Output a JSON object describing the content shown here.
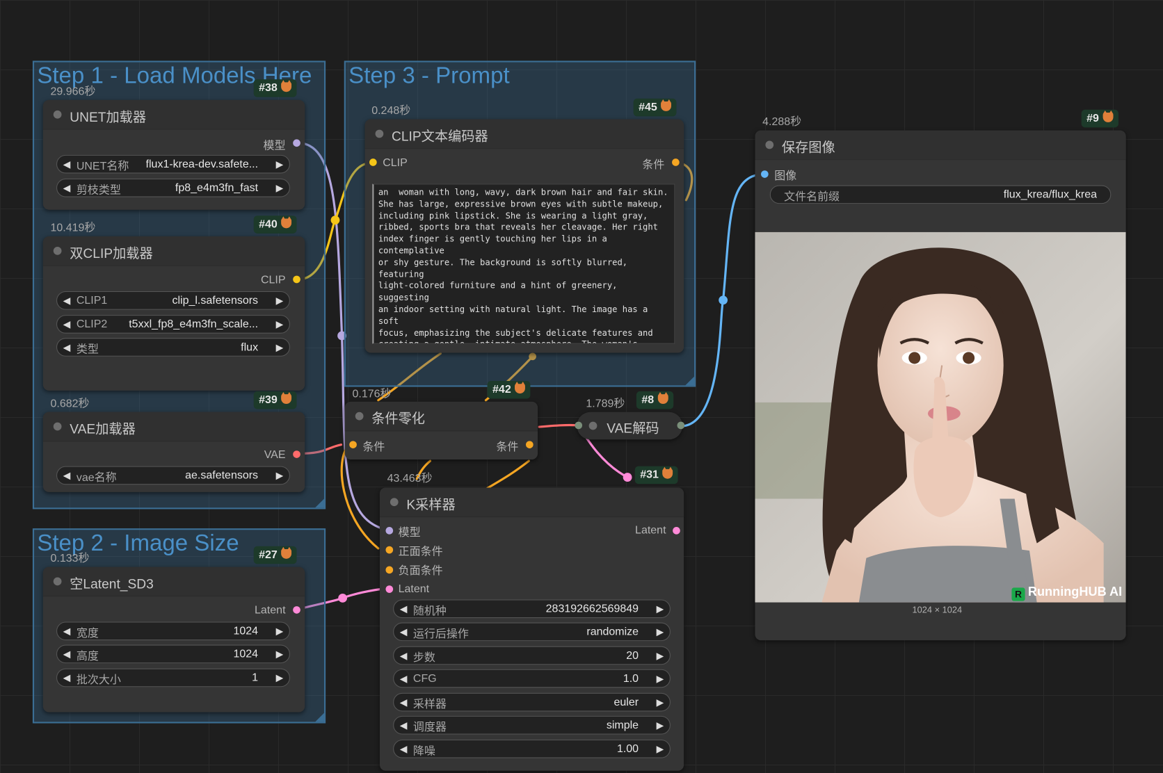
{
  "colors": {
    "model": "#b6a8e0",
    "clip": "#f5c518",
    "vae": "#ff6b6b",
    "conditioning": "#f5a623",
    "latent": "#ff8ad8",
    "image": "#64b5f6",
    "group": "#3b6e94"
  },
  "groups": {
    "step1": "Step 1 - Load Models Here",
    "step2": "Step 2 - Image Size",
    "step3": "Step 3 - Prompt"
  },
  "nodes": {
    "unet": {
      "time": "29.966秒",
      "badge": "#38",
      "title": "UNET加载器",
      "output": "模型",
      "widgets": [
        {
          "label": "UNET名称",
          "value": "flux1-krea-dev.safete..."
        },
        {
          "label": "剪枝类型",
          "value": "fp8_e4m3fn_fast"
        }
      ]
    },
    "dualclip": {
      "time": "10.419秒",
      "badge": "#40",
      "title": "双CLIP加载器",
      "output": "CLIP",
      "widgets": [
        {
          "label": "CLIP1",
          "value": "clip_l.safetensors"
        },
        {
          "label": "CLIP2",
          "value": "t5xxl_fp8_e4m3fn_scale..."
        },
        {
          "label": "类型",
          "value": "flux"
        }
      ]
    },
    "vaeloader": {
      "time": "0.682秒",
      "badge": "#39",
      "title": "VAE加载器",
      "output": "VAE",
      "widgets": [
        {
          "label": "vae名称",
          "value": "ae.safetensors"
        }
      ]
    },
    "latent": {
      "time": "0.133秒",
      "badge": "#27",
      "title": "空Latent_SD3",
      "output": "Latent",
      "widgets": [
        {
          "label": "宽度",
          "value": "1024"
        },
        {
          "label": "高度",
          "value": "1024"
        },
        {
          "label": "批次大小",
          "value": "1"
        }
      ]
    },
    "clipencode": {
      "time": "0.248秒",
      "badge": "#45",
      "title": "CLIP文本编码器",
      "input": "CLIP",
      "output": "条件",
      "prompt": "an  woman with long, wavy, dark brown hair and fair skin.\nShe has large, expressive brown eyes with subtle makeup,\nincluding pink lipstick. She is wearing a light gray,\nribbed, sports bra that reveals her cleavage. Her right\nindex finger is gently touching her lips in a contemplative\nor shy gesture. The background is softly blurred, featuring\nlight-colored furniture and a hint of greenery, suggesting\nan indoor setting with natural light. The image has a soft\nfocus, emphasizing the subject's delicate features and\ncreating a gentle, intimate atmosphere. The woman's overall\nappearance is youthful and attractive."
    },
    "zero": {
      "time": "0.176秒",
      "badge": "#42",
      "title": "条件零化",
      "input": "条件",
      "output": "条件"
    },
    "vaedecode": {
      "time": "1.789秒",
      "badge": "#8",
      "title": "VAE解码"
    },
    "ksampler": {
      "time": "43.463秒",
      "badge": "#31",
      "title": "K采样器",
      "inputs": [
        "模型",
        "正面条件",
        "负面条件",
        "Latent"
      ],
      "output": "Latent",
      "widgets": [
        {
          "label": "随机种",
          "value": "283192662569849"
        },
        {
          "label": "运行后操作",
          "value": "randomize"
        },
        {
          "label": "步数",
          "value": "20"
        },
        {
          "label": "CFG",
          "value": "1.0"
        },
        {
          "label": "采样器",
          "value": "euler"
        },
        {
          "label": "调度器",
          "value": "simple"
        },
        {
          "label": "降噪",
          "value": "1.00"
        }
      ]
    },
    "saveimage": {
      "time": "4.288秒",
      "badge": "#9",
      "title": "保存图像",
      "input": "图像",
      "widget": {
        "label": "文件名前缀",
        "value": "flux_krea/flux_krea"
      },
      "size_caption": "1024 × 1024",
      "watermark": "RunningHUB AI",
      "watermark_logo": "R"
    }
  }
}
